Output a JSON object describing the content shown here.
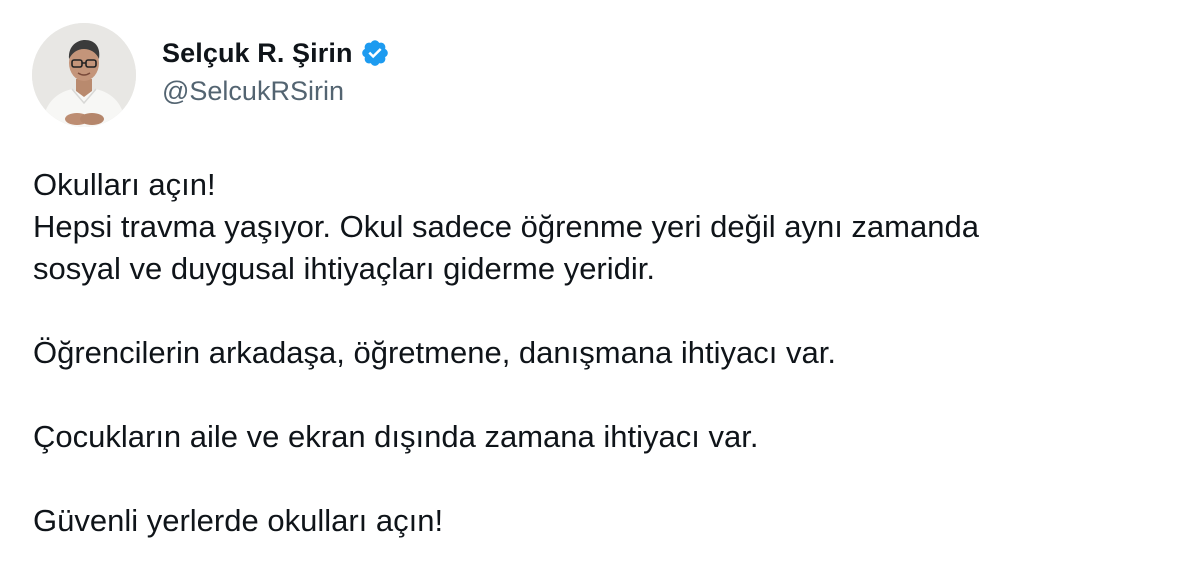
{
  "author": {
    "display_name": "Selçuk R. Şirin",
    "handle": "@SelcukRSirin",
    "verified_icon": "verified-badge-icon",
    "verified_color": "#1d9bf0"
  },
  "tweet": {
    "lines": [
      "Okulları açın!",
      "Hepsi travma yaşıyor. Okul sadece öğrenme yeri değil aynı zamanda",
      "sosyal ve duygusal ihtiyaçları giderme yeridir.",
      "Öğrencilerin arkadaşa, öğretmene, danışmana ihtiyacı var.",
      "Çocukların aile ve ekran dışında zamana ihtiyacı var.",
      "Güvenli yerlerde okulları açın!"
    ]
  }
}
